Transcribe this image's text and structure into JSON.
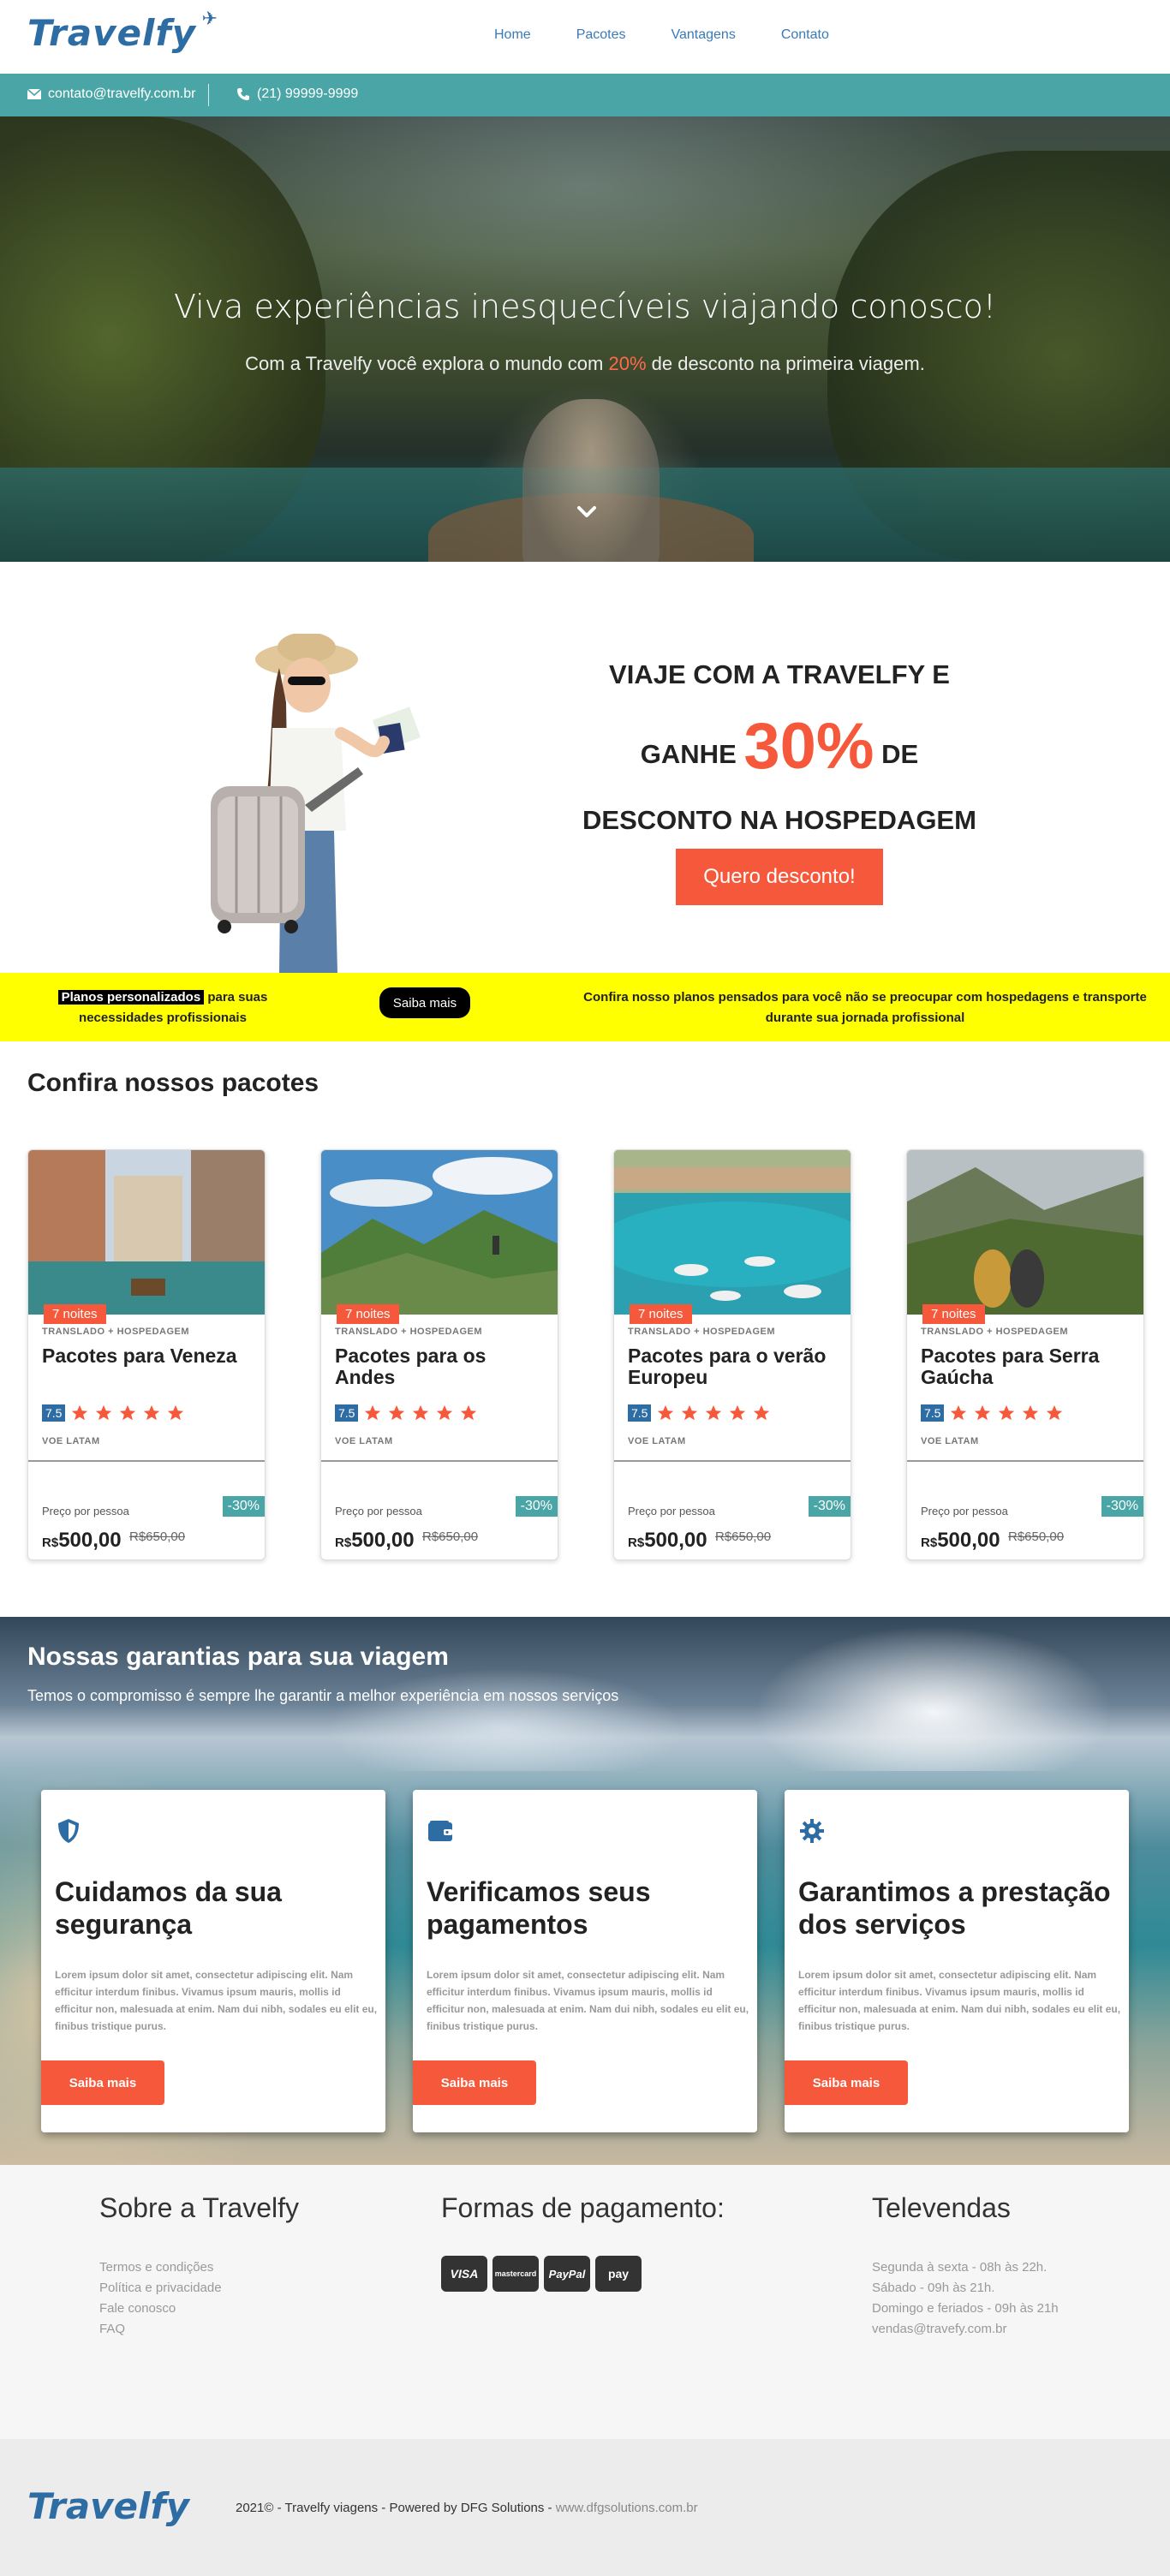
{
  "brand": {
    "logo": "Travelfy"
  },
  "nav": {
    "items": [
      "Home",
      "Pacotes",
      "Vantagens",
      "Contato"
    ]
  },
  "contact": {
    "email": "contato@travelfy.com.br",
    "phone": "(21) 99999-9999"
  },
  "hero": {
    "title": "Viva experiências inesquecíveis viajando conosco!",
    "sub_before": "Com a Travelfy você explora o mundo com ",
    "sub_highlight": "20%",
    "sub_after": " de desconto na primeira viagem."
  },
  "promo": {
    "line1": "VIAJE COM A TRAVELFY E",
    "line2_a": "GANHE ",
    "line2_big": "30%",
    "line2_b": " DE",
    "line3": "DESCONTO NA HOSPEDAGEM",
    "button": "Quero desconto!"
  },
  "yellow": {
    "tag": "Planos personalizados",
    "left_text": " para suas necessidades profissionais",
    "button": "Saiba mais",
    "right_text": "Confira nosso planos pensados para você não se preocupar com hospedagens e transporte durante sua jornada profissional"
  },
  "packages": {
    "title": "Confira nossos pacotes",
    "items": [
      {
        "nights": "7 noites",
        "sub": "TRANSLADO + HOSPEDAGEM",
        "name": "Pacotes para Veneza",
        "score": "7.5",
        "airline": "VOE LATAM",
        "per": "Preço por pessoa",
        "discount": "-30%",
        "currency": "R$",
        "price": "500,00",
        "old": "R$650,00"
      },
      {
        "nights": "7 noites",
        "sub": "TRANSLADO + HOSPEDAGEM",
        "name": "Pacotes para os Andes",
        "score": "7.5",
        "airline": "VOE LATAM",
        "per": "Preço por pessoa",
        "discount": "-30%",
        "currency": "R$",
        "price": "500,00",
        "old": "R$650,00"
      },
      {
        "nights": "7 noites",
        "sub": "TRANSLADO + HOSPEDAGEM",
        "name": "Pacotes para o verão Europeu",
        "score": "7.5",
        "airline": "VOE LATAM",
        "per": "Preço por pessoa",
        "discount": "-30%",
        "currency": "R$",
        "price": "500,00",
        "old": "R$650,00"
      },
      {
        "nights": "7 noites",
        "sub": "TRANSLADO + HOSPEDAGEM",
        "name": "Pacotes para Serra Gaúcha",
        "score": "7.5",
        "airline": "VOE LATAM",
        "per": "Preço por pessoa",
        "discount": "-30%",
        "currency": "R$",
        "price": "500,00",
        "old": "R$650,00"
      }
    ]
  },
  "guarantees": {
    "title": "Nossas garantias para sua viagem",
    "sub": "Temos o compromisso é sempre lhe garantir a melhor experiência em nossos serviços",
    "items": [
      {
        "icon": "shield-icon",
        "title": "Cuidamos da sua segurança",
        "text": "Lorem ipsum dolor sit amet, consectetur adipiscing elit. Nam efficitur interdum finibus. Vivamus ipsum mauris, mollis id efficitur non, malesuada at enim. Nam dui nibh, sodales eu elit eu, finibus tristique purus.",
        "button": "Saiba mais"
      },
      {
        "icon": "wallet-icon",
        "title": "Verificamos seus pagamentos",
        "text": "Lorem ipsum dolor sit amet, consectetur adipiscing elit. Nam efficitur interdum finibus. Vivamus ipsum mauris, mollis id efficitur non, malesuada at enim. Nam dui nibh, sodales eu elit eu, finibus tristique purus.",
        "button": "Saiba mais"
      },
      {
        "icon": "gear-icon",
        "title": "Garantimos a prestação dos serviços",
        "text": "Lorem ipsum dolor sit amet, consectetur adipiscing elit. Nam efficitur interdum finibus. Vivamus ipsum mauris, mollis id efficitur non, malesuada at enim. Nam dui nibh, sodales eu elit eu, finibus tristique purus.",
        "button": "Saiba mais"
      }
    ]
  },
  "footer": {
    "about_title": "Sobre a Travelfy",
    "about_links": [
      "Termos e condições",
      "Política e privacidade",
      "Fale conosco",
      "FAQ"
    ],
    "pay_title": "Formas de pagamento:",
    "pay_methods": [
      "VISA",
      "mastercard",
      "PayPal",
      "pay"
    ],
    "sales_title": "Televendas",
    "sales_lines": [
      "Segunda à sexta - 08h às 22h.",
      "Sábado - 09h às 21h.",
      "Domingo e feriados - 09h às 21h",
      "vendas@travefy.com.br"
    ],
    "copy": "2021© - Travelfy viagens - Powered by DFG Solutions - ",
    "site": "www.dfgsolutions.com.br"
  },
  "colors": {
    "accent": "#f5583a",
    "teal": "#4aa6a6",
    "brand": "#2e6da4",
    "yellow": "#ffff00"
  }
}
